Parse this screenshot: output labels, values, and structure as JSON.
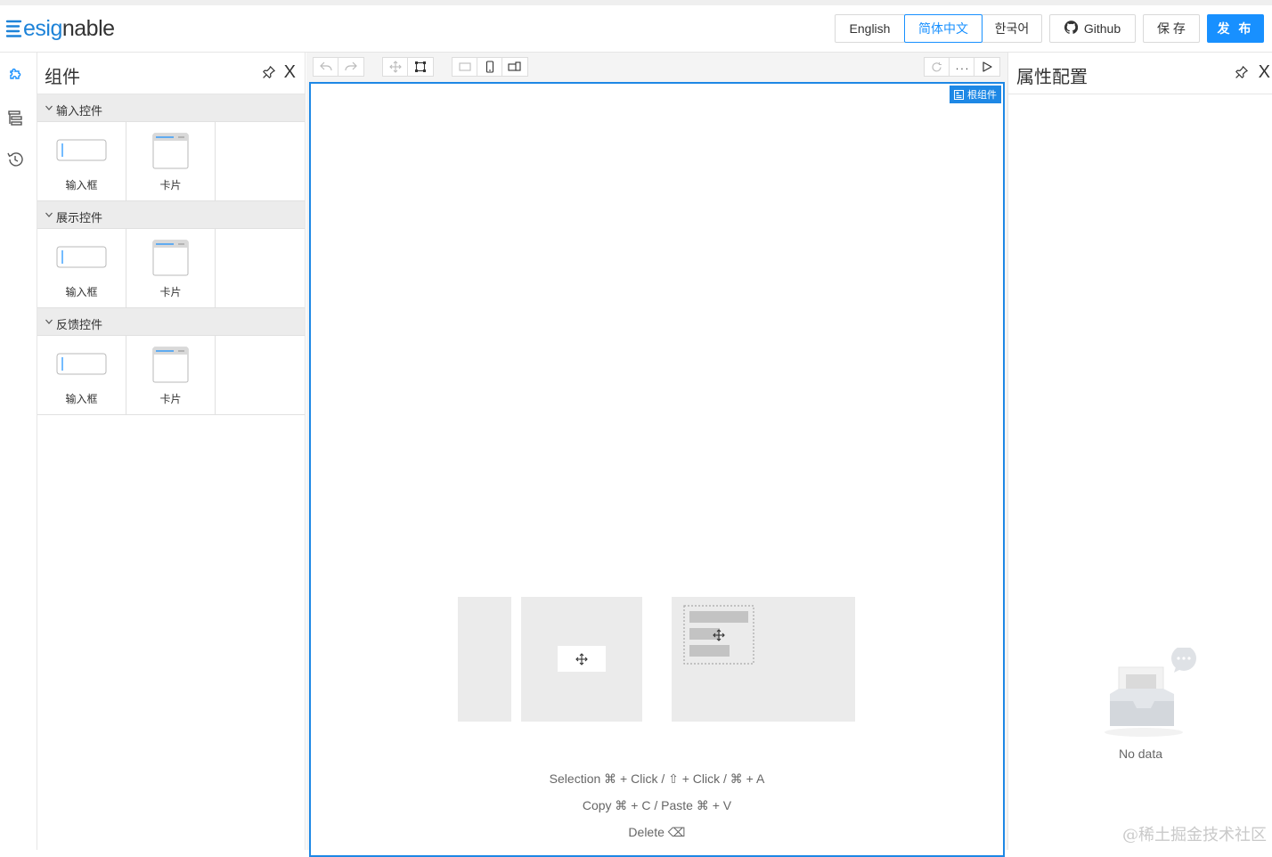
{
  "header": {
    "logo": {
      "part1": "esig",
      "part2": "nable"
    },
    "languages": [
      "English",
      "简体中文",
      "한국어"
    ],
    "active_language": "简体中文",
    "github_label": "Github",
    "save_label": "保 存",
    "publish_label": "发 布"
  },
  "components_panel": {
    "title": "组件",
    "close_glyph": "X",
    "groups": [
      {
        "label": "输入控件",
        "items": [
          "输入框",
          "卡片"
        ]
      },
      {
        "label": "展示控件",
        "items": [
          "输入框",
          "卡片"
        ]
      },
      {
        "label": "反馈控件",
        "items": [
          "输入框",
          "卡片"
        ]
      }
    ]
  },
  "canvas": {
    "root_badge": "根组件",
    "hints": [
      "Selection ⌘ + Click / ⇧ + Click / ⌘ + A",
      "Copy ⌘ + C / Paste ⌘ + V",
      "Delete ⌫"
    ]
  },
  "properties_panel": {
    "title": "属性配置",
    "close_glyph": "X",
    "empty_text": "No data"
  },
  "watermark": "@稀土掘金技术社区",
  "colors": {
    "accent": "#1890ff",
    "canvas_border": "#1e88e5"
  }
}
